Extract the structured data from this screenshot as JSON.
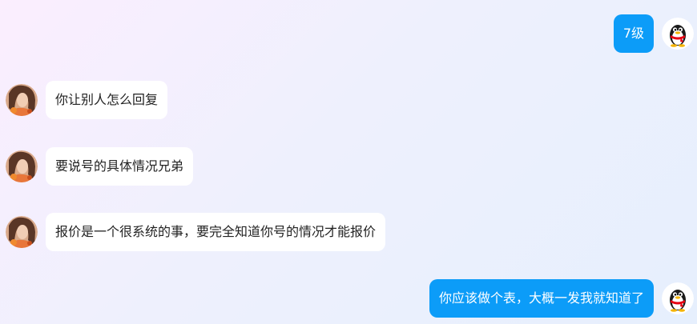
{
  "colors": {
    "outgoing_bubble": "#0c9cf8",
    "incoming_bubble": "#ffffff",
    "incoming_text": "#222222",
    "outgoing_text": "#ffffff"
  },
  "messages": [
    {
      "direction": "outgoing",
      "avatar_icon": "qq-penguin-avatar",
      "text": "7级"
    },
    {
      "direction": "incoming",
      "avatar_icon": "user-photo-avatar",
      "text": "你让别人怎么回复"
    },
    {
      "direction": "incoming",
      "avatar_icon": "user-photo-avatar",
      "text": "要说号的具体情况兄弟"
    },
    {
      "direction": "incoming",
      "avatar_icon": "user-photo-avatar",
      "text": "报价是一个很系统的事，要完全知道你号的情况才能报价"
    },
    {
      "direction": "outgoing",
      "avatar_icon": "qq-penguin-avatar",
      "text": "你应该做个表，大概一发我就知道了"
    }
  ]
}
